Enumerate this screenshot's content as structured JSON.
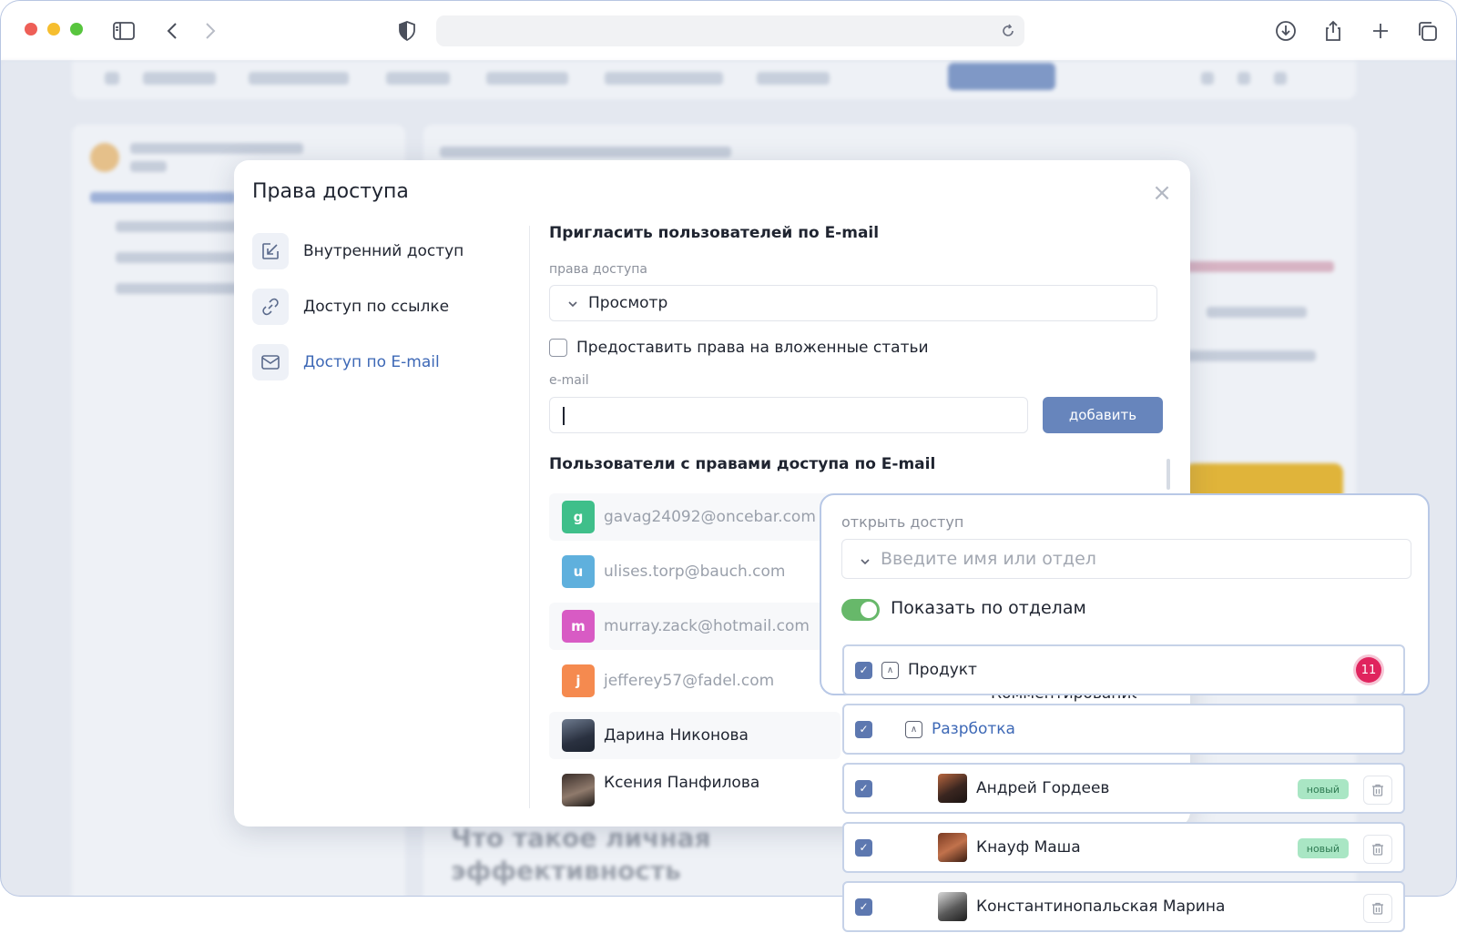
{
  "modal": {
    "title": "Права доступа",
    "nav": [
      {
        "label": "Внутренний доступ",
        "icon": "arrow-in-box-icon"
      },
      {
        "label": "Доступ по ссылке",
        "icon": "link-icon"
      },
      {
        "label": "Доступ по E-mail",
        "icon": "mail-icon"
      }
    ],
    "invite_title": "Пригласить пользователей по E-mail",
    "rights_label": "права доступа",
    "rights_value": "Просмотр",
    "nested_checkbox_label": "Предоставить права на вложенные статьи",
    "email_label": "e-mail",
    "add_button": "добавить",
    "users_title": "Пользователи с правами доступа по E-mail",
    "users": [
      {
        "initial": "g",
        "email": "gavag24092@oncebar.com",
        "color": "#3fbf8a"
      },
      {
        "initial": "u",
        "email": "ulises.torp@bauch.com",
        "color": "#5fb0dd"
      },
      {
        "initial": "m",
        "email": "murray.zack@hotmail.com",
        "color": "#d85bc4"
      },
      {
        "initial": "j",
        "email": "jefferey57@fadel.com",
        "color": "#f58a4f"
      },
      {
        "name": "Дарина Никонова"
      },
      {
        "name": "Ксения Панфилова"
      }
    ]
  },
  "panel": {
    "label": "открыть доступ",
    "select_placeholder": "Введите имя или отдел",
    "toggle_label": "Показать по отделам",
    "groups": [
      {
        "label": "Продукт",
        "count": "11"
      },
      {
        "label": "Разрботка"
      }
    ],
    "people": [
      {
        "name": "Андрей Гордеев",
        "badge": "новый"
      },
      {
        "name": "Кнауф Маша",
        "badge": "новый"
      },
      {
        "name": "Константинопальская Марина"
      }
    ],
    "peek_text": "Комментирование"
  },
  "background": {
    "headline": "Что такое личная эффективность"
  },
  "colors": {
    "accent": "#6785bc",
    "active_nav": "#3d68b6",
    "toggle_on": "#67b86a",
    "badge_red": "#e0245e",
    "new_badge": "#a9e6c4"
  }
}
